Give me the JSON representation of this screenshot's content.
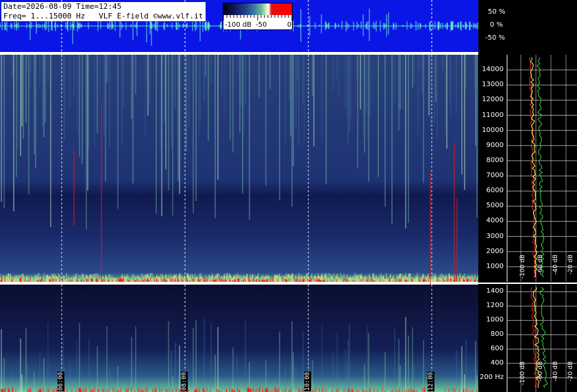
{
  "header": {
    "line1": "Date=2026-08-09 Time=12:45",
    "line2": "Freq= 1...15000 Hz   VLF E-field ©www.vlf.it"
  },
  "colorbar": {
    "labels": [
      "-100 dB",
      "-50",
      "0"
    ],
    "colors": [
      "#000010",
      "#22408a",
      "#6fbf9a",
      "#ffffff",
      "#ff0000"
    ]
  },
  "waveform_scale": [
    "50 %",
    "0 %",
    "-50 %"
  ],
  "colors": {
    "wave_background": "#0a16e6",
    "waveform": "#5fe0d0",
    "spectrum_red": "#ff2020",
    "spectrum_yellow": "#ffff60",
    "spectrum_green": "#40d040"
  },
  "chart_data": [
    {
      "type": "heatmap",
      "panel": "upper-spectrogram",
      "x_time_labels": [
        "06:00",
        "08:00",
        "10:00",
        "12:00"
      ],
      "y_freq_range": [
        0,
        15000
      ],
      "y_tick_labels": [
        "1000",
        "2000",
        "3000",
        "4000",
        "5000",
        "6000",
        "7000",
        "8000",
        "9000",
        "10000",
        "11000",
        "12000",
        "13000",
        "14000"
      ],
      "db_labels": [
        "-100 dB",
        "-60 dB",
        "-40 dB",
        "-20 dB"
      ]
    },
    {
      "type": "heatmap",
      "panel": "lower-spectrogram",
      "x_time_labels": [
        "06:00",
        "08:00",
        "10:00",
        "12:00"
      ],
      "y_freq_range": [
        0,
        1500
      ],
      "y_tick_labels": [
        "200 Hz",
        "400",
        "600",
        "800",
        "1000",
        "1200",
        "1400"
      ],
      "db_labels": [
        "-100 dB",
        "-60 dB",
        "-40 dB",
        "-20 dB"
      ]
    }
  ]
}
